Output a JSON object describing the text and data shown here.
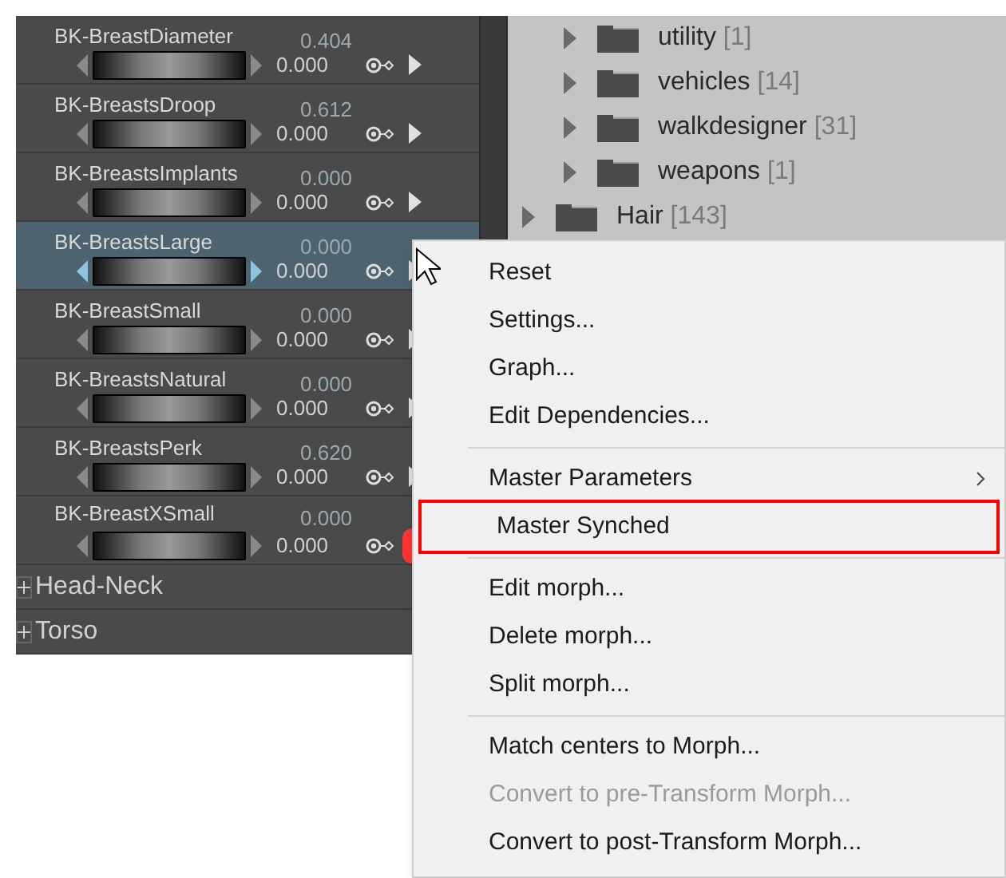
{
  "morphs": [
    {
      "name": "BK-BreastDiameter",
      "value": "0.404",
      "base": "0.000",
      "selected": false,
      "master_dot": false
    },
    {
      "name": "BK-BreastsDroop",
      "value": "0.612",
      "base": "0.000",
      "selected": false,
      "master_dot": false
    },
    {
      "name": "BK-BreastsImplants",
      "value": "0.000",
      "base": "0.000",
      "selected": false,
      "master_dot": false
    },
    {
      "name": "BK-BreastsLarge",
      "value": "0.000",
      "base": "0.000",
      "selected": true,
      "master_dot": false
    },
    {
      "name": "BK-BreastSmall",
      "value": "0.000",
      "base": "0.000",
      "selected": false,
      "master_dot": false
    },
    {
      "name": "BK-BreastsNatural",
      "value": "0.000",
      "base": "0.000",
      "selected": false,
      "master_dot": false
    },
    {
      "name": "BK-BreastsPerk",
      "value": "0.620",
      "base": "0.000",
      "selected": false,
      "master_dot": false
    },
    {
      "name": "BK-BreastXSmall",
      "value": "0.000",
      "base": "0.000",
      "selected": false,
      "master_dot": true
    }
  ],
  "groups": [
    {
      "label": "Head-Neck",
      "expanded": false
    },
    {
      "label": "Torso",
      "expanded": false
    }
  ],
  "tree": {
    "visible_children": [
      {
        "label": "utility",
        "count": "[1]",
        "expanded": false
      },
      {
        "label": "vehicles",
        "count": "[14]",
        "expanded": false
      },
      {
        "label": "walkdesigner",
        "count": "[31]",
        "expanded": false
      },
      {
        "label": "weapons",
        "count": "[1]",
        "expanded": false
      }
    ],
    "siblings": [
      {
        "label": "Hair",
        "count": "[143]",
        "expanded": false
      }
    ]
  },
  "context_menu": {
    "groups": [
      [
        {
          "label": "Reset",
          "disabled": false,
          "submenu": false,
          "highlighted": false
        },
        {
          "label": "Settings...",
          "disabled": false,
          "submenu": false,
          "highlighted": false
        },
        {
          "label": "Graph...",
          "disabled": false,
          "submenu": false,
          "highlighted": false
        },
        {
          "label": "Edit Dependencies...",
          "disabled": false,
          "submenu": false,
          "highlighted": false
        }
      ],
      [
        {
          "label": "Master Parameters",
          "disabled": false,
          "submenu": true,
          "highlighted": false
        },
        {
          "label": "Master Synched",
          "disabled": false,
          "submenu": false,
          "highlighted": true
        }
      ],
      [
        {
          "label": "Edit morph...",
          "disabled": false,
          "submenu": false,
          "highlighted": false
        },
        {
          "label": "Delete morph...",
          "disabled": false,
          "submenu": false,
          "highlighted": false
        },
        {
          "label": "Split morph...",
          "disabled": false,
          "submenu": false,
          "highlighted": false
        }
      ],
      [
        {
          "label": "Match centers to Morph...",
          "disabled": false,
          "submenu": false,
          "highlighted": false
        },
        {
          "label": "Convert to pre-Transform Morph...",
          "disabled": true,
          "submenu": false,
          "highlighted": false
        },
        {
          "label": "Convert to post-Transform Morph...",
          "disabled": false,
          "submenu": false,
          "highlighted": false
        }
      ]
    ]
  }
}
